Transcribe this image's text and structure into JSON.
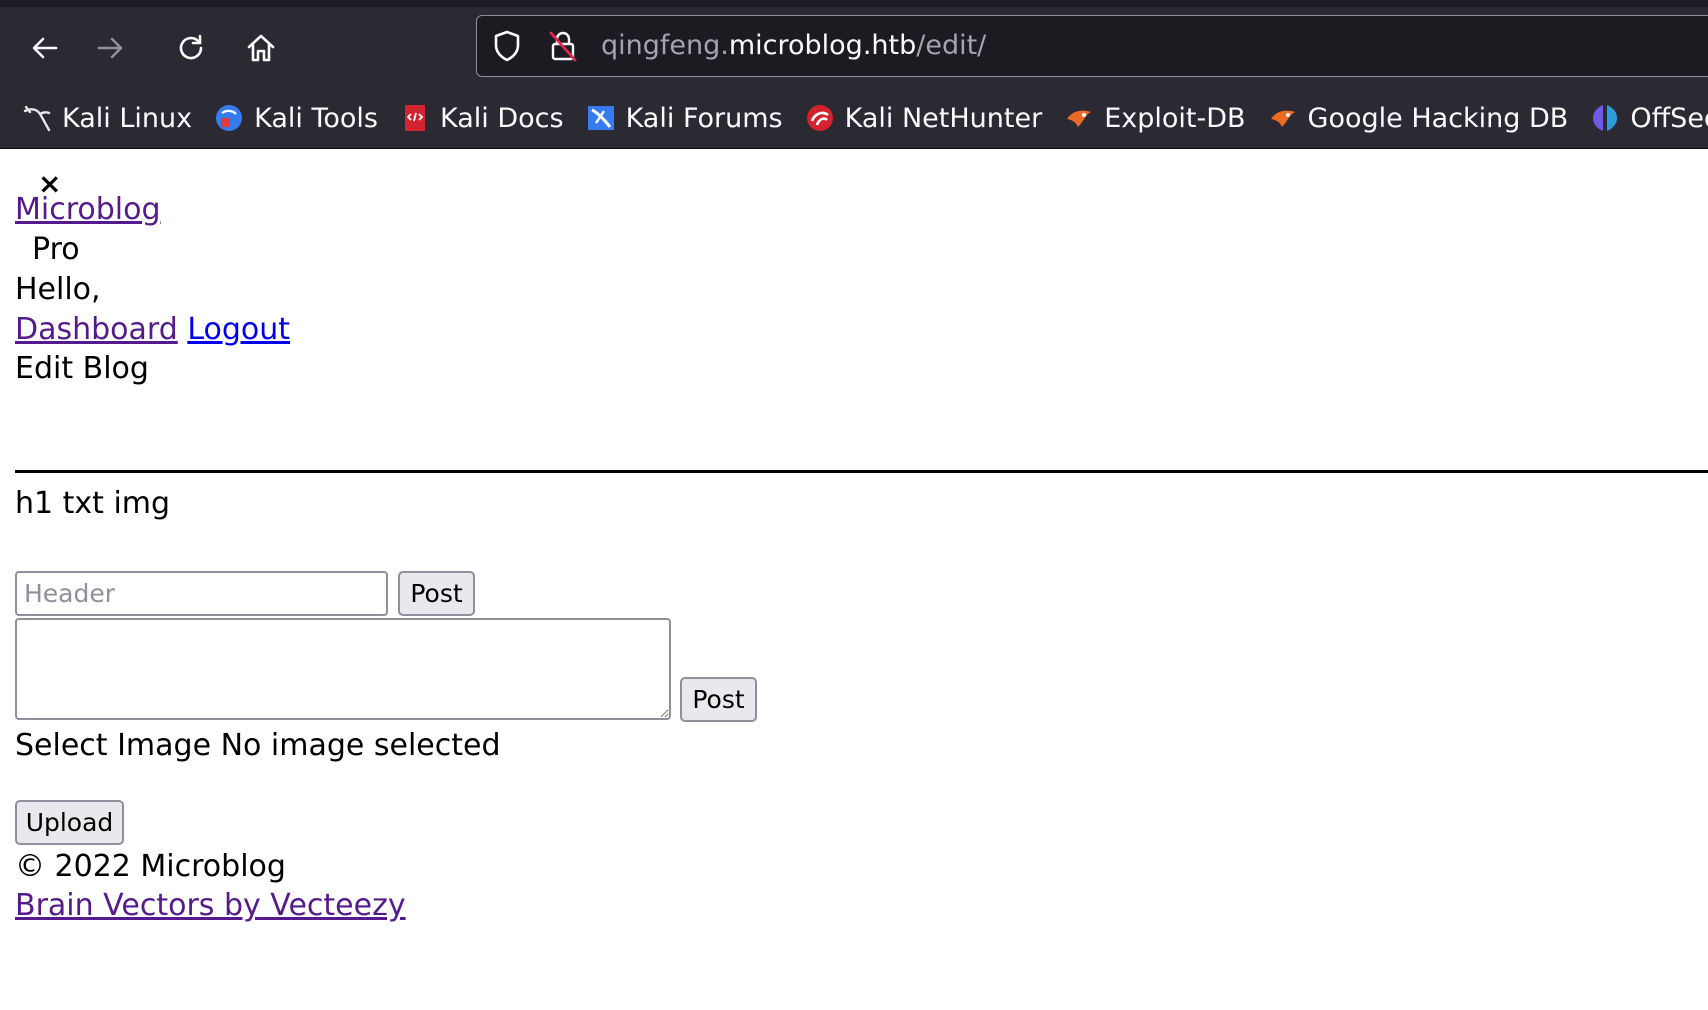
{
  "browser": {
    "url_host_prefix": "qingfeng.",
    "url_host_domain": "microblog.htb",
    "url_path": "/edit/",
    "bookmarks": [
      {
        "label": "Kali Linux",
        "icon": "kali-dragon-icon"
      },
      {
        "label": "Kali Tools",
        "icon": "kali-tools-icon"
      },
      {
        "label": "Kali Docs",
        "icon": "kali-docs-icon"
      },
      {
        "label": "Kali Forums",
        "icon": "kali-forums-icon"
      },
      {
        "label": "Kali NetHunter",
        "icon": "kali-nethunter-icon"
      },
      {
        "label": "Exploit-DB",
        "icon": "exploit-db-icon"
      },
      {
        "label": "Google Hacking DB",
        "icon": "ghdb-icon"
      },
      {
        "label": "OffSec",
        "icon": "offsec-icon"
      }
    ]
  },
  "page": {
    "close_symbol": "×",
    "brand_link": "Microblog",
    "brand_suffix": "Pro",
    "greeting": "Hello,",
    "dashboard_link": "Dashboard",
    "logout_link": "Logout",
    "heading": "Edit Blog",
    "tools_line": "h1 txt img",
    "header_placeholder": "Header",
    "post_button_1": "Post",
    "post_button_2": "Post",
    "select_image_text": "Select Image No image selected",
    "upload_button": "Upload",
    "footer_copyright": "© 2022 Microblog",
    "footer_credit_link": "Brain Vectors by Vecteezy"
  },
  "colors": {
    "chrome_bg": "#2b2a33",
    "visited_link": "#551a8b",
    "unvisited_link": "#0000ee"
  }
}
